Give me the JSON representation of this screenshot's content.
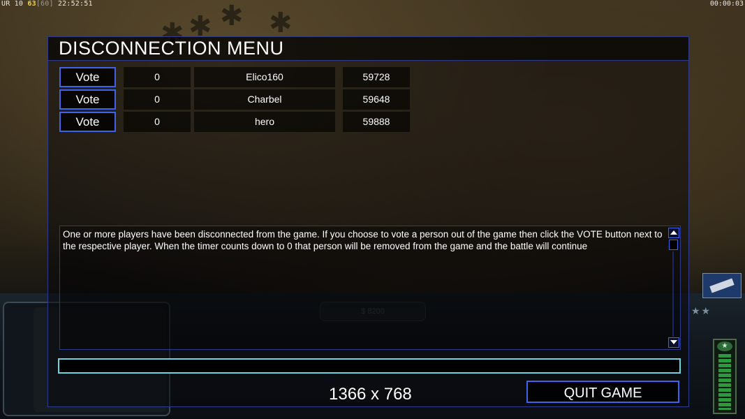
{
  "hud": {
    "top_left_prefix": "UR 10",
    "top_left_highlight": "63",
    "top_left_bracket": "[60]",
    "top_left_clock": "22:52:51",
    "top_right_timer": "00:00:03",
    "money": "$ 8200"
  },
  "menu": {
    "title": "DISCONNECTION MENU",
    "players": [
      {
        "vote_label": "Vote",
        "timer": "0",
        "name": "Elico160",
        "port": "59728"
      },
      {
        "vote_label": "Vote",
        "timer": "0",
        "name": "Charbel",
        "port": "59648"
      },
      {
        "vote_label": "Vote",
        "timer": "0",
        "name": "hero",
        "port": "59888"
      }
    ],
    "message": "One or more players have been disconnected from the game. If you choose to vote a person out of the game then click the VOTE button next to the respective player. When the timer counts down to 0 that person will be removed from the game and the battle will continue",
    "chat_value": "",
    "resolution": "1366 x 768",
    "quit_label": "QUIT GAME"
  },
  "colors": {
    "border_blue": "#3d64e8",
    "input_cyan": "#6fd3e0",
    "highlight_yellow": "#f2d43a"
  }
}
